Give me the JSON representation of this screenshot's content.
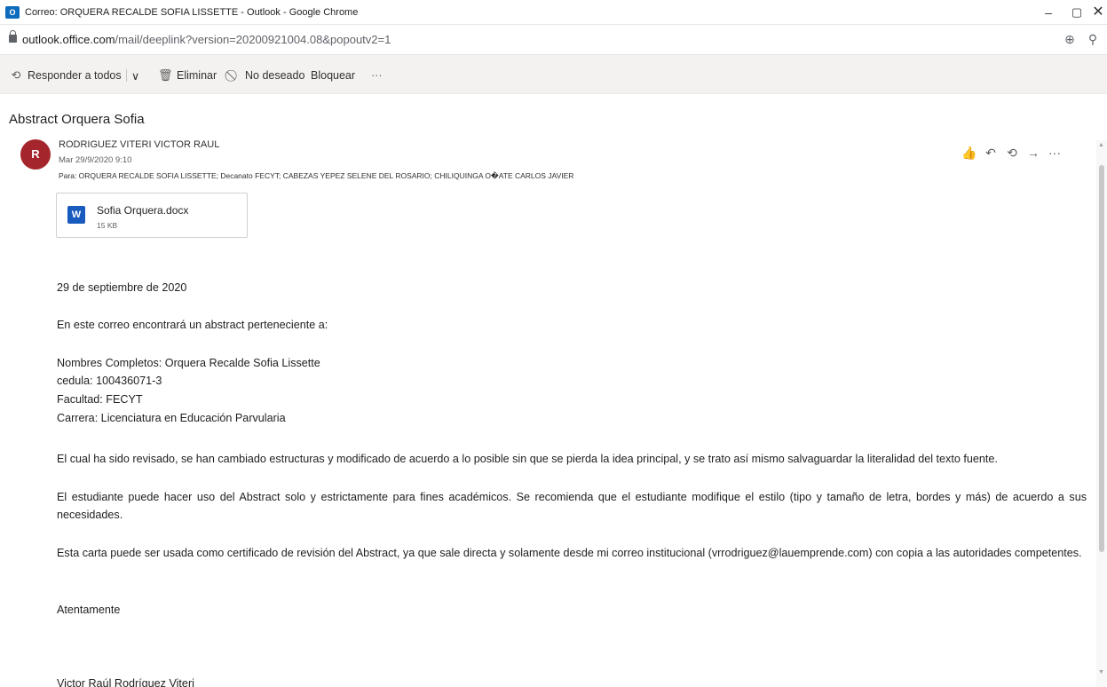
{
  "window": {
    "title": "Correo: ORQUERA RECALDE SOFIA LISSETTE - Outlook - Google Chrome",
    "app_icon_letter": "O",
    "minimize": "–",
    "maximize": "▢",
    "close": "✕"
  },
  "address_bar": {
    "host": "outlook.office.com",
    "path": "/mail/deeplink?version=20200921004.08&popoutv2=1",
    "zoom_icon": "⊕",
    "search_icon": "⚲"
  },
  "commands": {
    "reply_all": "Responder a todos",
    "chevron": "∨",
    "delete": "Eliminar",
    "junk": "No deseado",
    "block": "Bloquear",
    "more": "···"
  },
  "message": {
    "subject": "Abstract Orquera Sofia",
    "avatar_initial": "R",
    "avatar_color": "#a4262c",
    "sender": "RODRIGUEZ VITERI VICTOR RAUL",
    "date": "Mar 29/9/2020 9:10",
    "recipients": "Para:  ORQUERA RECALDE SOFIA LISSETTE; Decanato FECYT; CABEZAS YEPEZ SELENE DEL ROSARIO; CHILIQUINGA O�ATE CARLOS JAVIER",
    "actions": {
      "like": "👍",
      "reply": "↶",
      "reply_all": "⟲",
      "forward": "→",
      "more": "···"
    },
    "attachment": {
      "name": "Sofia Orquera.docx",
      "size": "15 KB",
      "icon_letter": "W"
    }
  },
  "body": {
    "date_line": "29 de septiembre de 2020",
    "intro": "En este correo encontrará un abstract  perteneciente a:",
    "names": "Nombres Completos: Orquera Recalde Sofia Lissette",
    "cedula": "cedula: 100436071-3",
    "faculty": "Facultad: FECYT",
    "career": "Carrera: Licenciatura en Educación Parvularia",
    "para1": "El cual ha sido revisado, se han cambiado estructuras y modificado de acuerdo a lo posible sin que se pierda la idea principal, y se trato  así mismo salvaguardar la literalidad del texto fuente.",
    "para2": "El estudiante puede hacer uso del Abstract solo y estrictamente para fines académicos. Se recomienda que el estudiante modifique el estilo (tipo y tamaño de letra, bordes y más) de acuerdo a sus necesidades.",
    "para3": "Esta carta puede ser usada como certificado de revisión del Abstract, ya que sale directa y solamente desde mi correo institucional (vrrodriguez@lauemprende.com) con copia a las autoridades competentes.",
    "closing": "Atentamente",
    "signature": "Victor Raúl Rodríguez Viteri"
  }
}
